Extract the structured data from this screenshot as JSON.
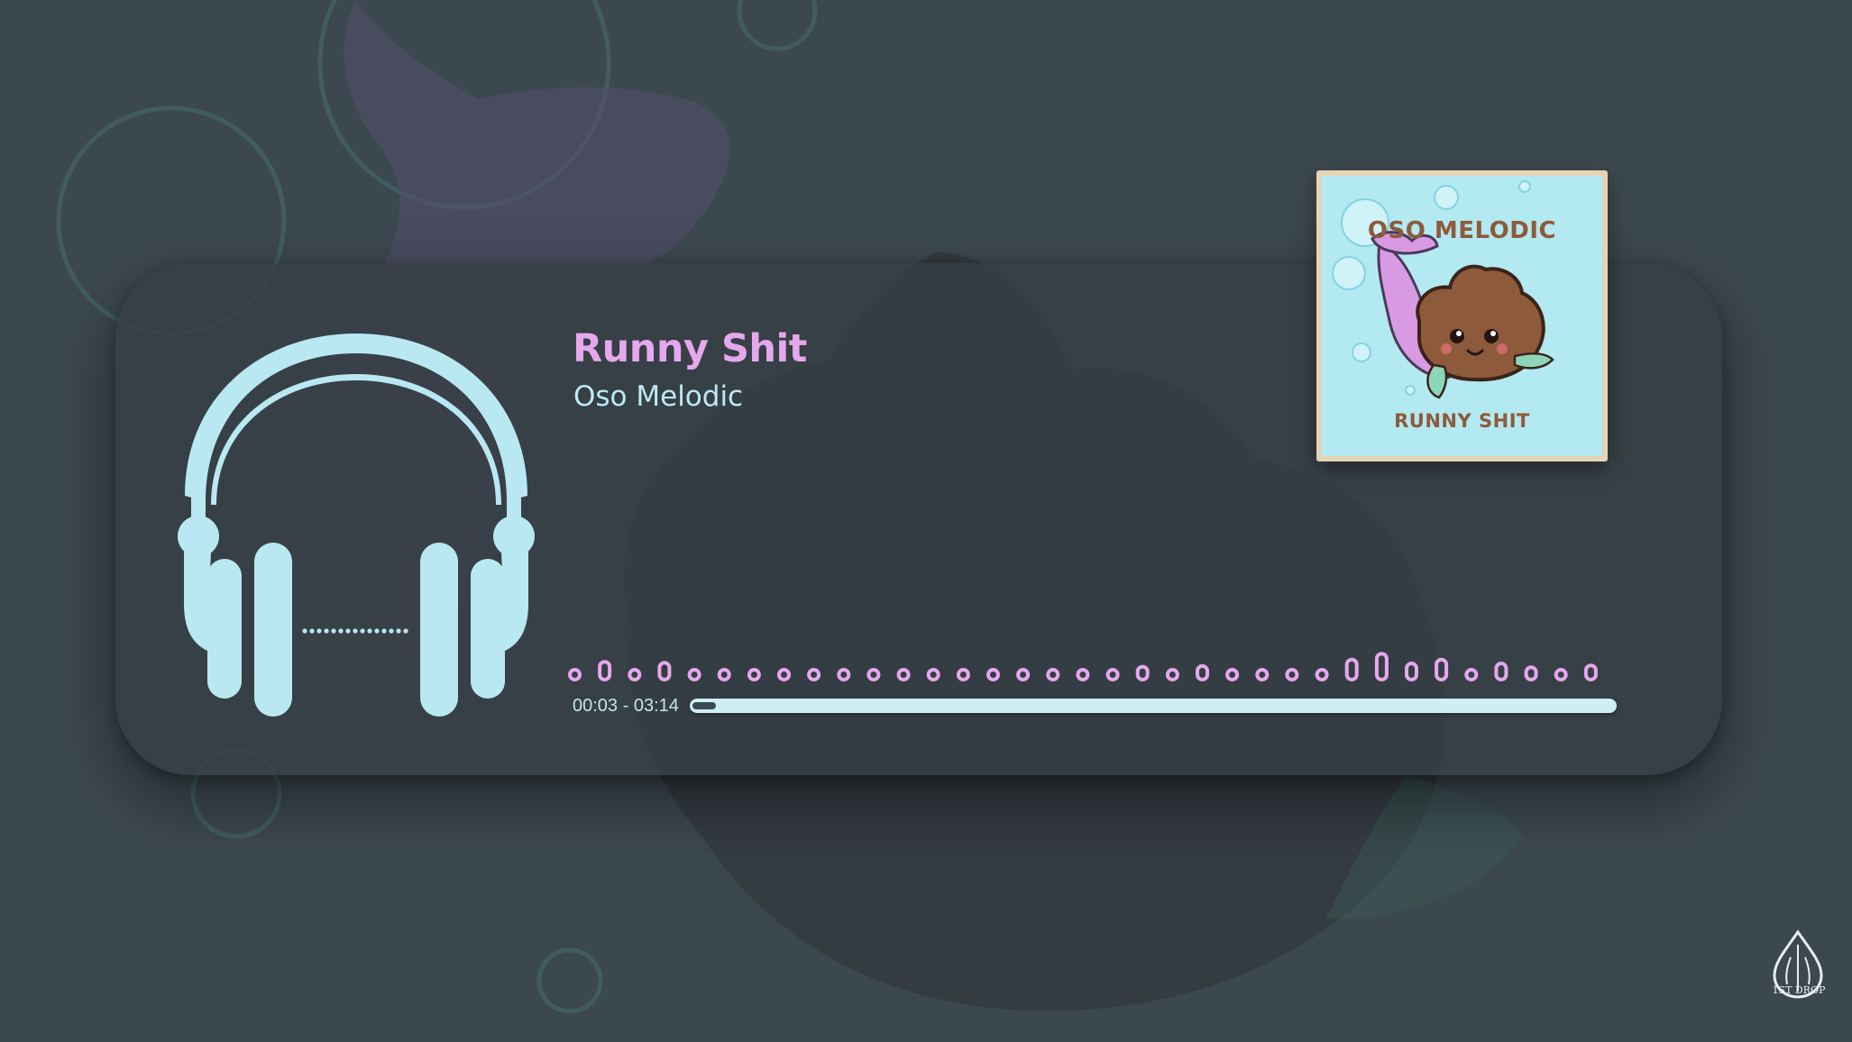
{
  "track": {
    "title": "Runny Shit",
    "artist": "Oso Melodic"
  },
  "cover": {
    "title": "OSO MELODIC",
    "subtitle": "RUNNY SHIT"
  },
  "player": {
    "time_readout": "00:03 - 03:14",
    "progress": 0.025,
    "visualizer_levels": [
      0.12,
      0.55,
      0.12,
      0.52,
      0.25,
      0.25,
      0.25,
      0.25,
      0.25,
      0.28,
      0.28,
      0.22,
      0.25,
      0.25,
      0.2,
      0.2,
      0.3,
      0.18,
      0.18,
      0.4,
      0.22,
      0.42,
      0.3,
      0.25,
      0.3,
      0.18,
      0.62,
      0.8,
      0.5,
      0.62,
      0.15,
      0.5,
      0.38,
      0.28,
      0.44
    ]
  },
  "brand": {
    "name": "1ST DROP"
  },
  "colors": {
    "accent": "#e6a8ec",
    "icon": "#b9e8f2",
    "artist_text": "#bde9f2",
    "progress_track": "#cdeff4",
    "background": "#3c484f"
  }
}
